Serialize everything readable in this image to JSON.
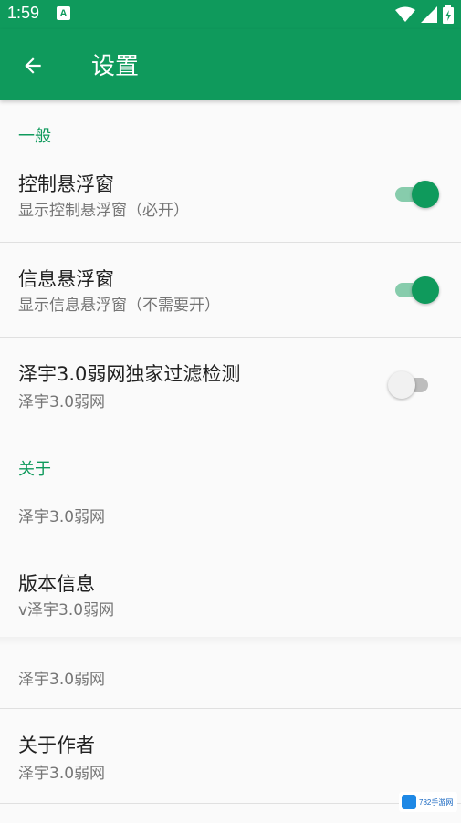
{
  "status_bar": {
    "time": "1:59",
    "notification_icon": "A",
    "icons": [
      "wifi-icon",
      "signal-icon",
      "battery-icon"
    ]
  },
  "app_bar": {
    "title": "设置",
    "back_icon": "arrow-left-icon"
  },
  "sections": {
    "general": {
      "header": "一般",
      "prefs": [
        {
          "title": "控制悬浮窗",
          "summary": "显示控制悬浮窗（必开）",
          "switch_on": true
        },
        {
          "title": "信息悬浮窗",
          "summary": "显示信息悬浮窗（不需要开）",
          "switch_on": true
        },
        {
          "title": "泽宇3.0弱网独家过滤检测",
          "summary": "泽宇3.0弱网",
          "switch_on": false
        }
      ]
    },
    "about": {
      "header": "关于",
      "prefs": [
        {
          "summary": "泽宇3.0弱网"
        },
        {
          "title": "版本信息",
          "summary": "v泽宇3.0弱网"
        },
        {
          "summary": "泽宇3.0弱网"
        },
        {
          "title": "关于作者",
          "summary": "泽宇3.0弱网"
        }
      ]
    }
  },
  "watermark": {
    "text": "782手游网"
  },
  "colors": {
    "primary": "#0f9a5c",
    "accent_track": "#87ccac"
  }
}
